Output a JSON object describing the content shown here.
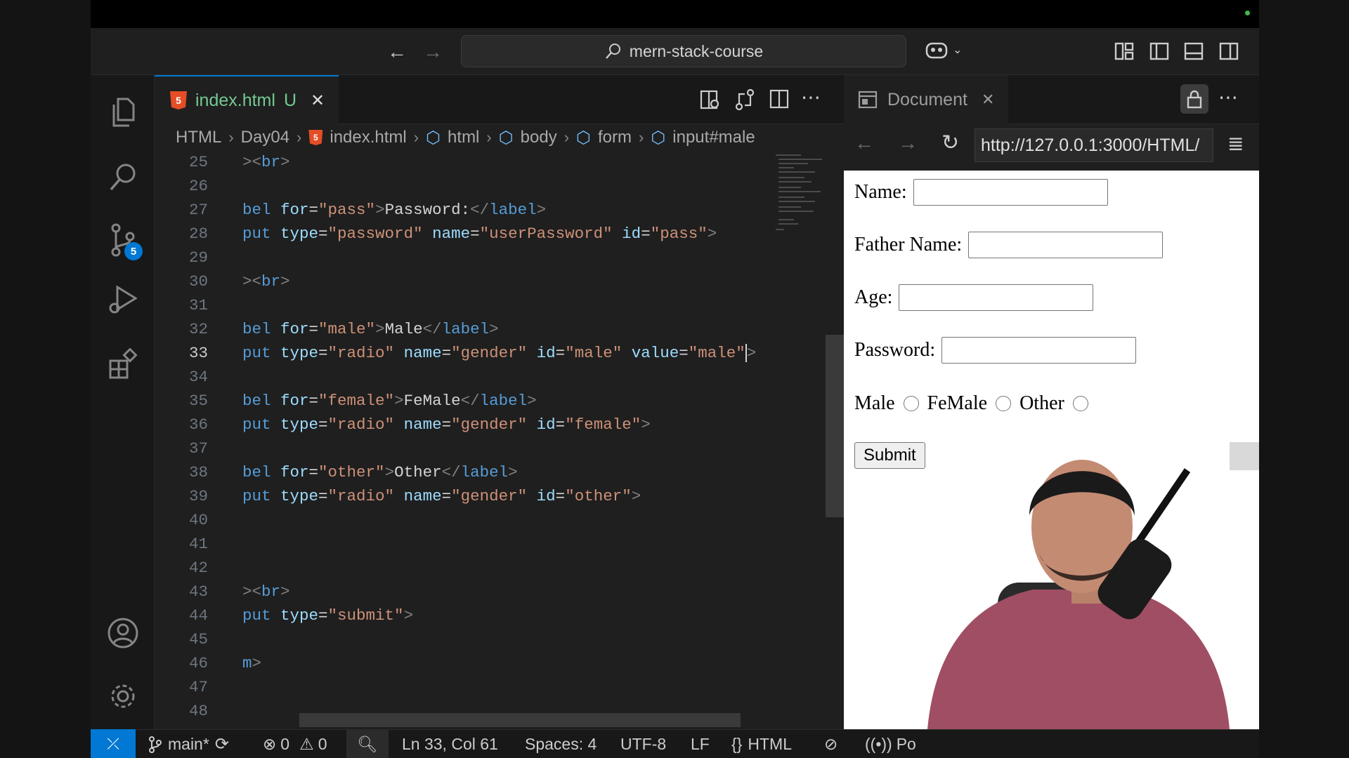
{
  "window": {
    "search_text": "mern-stack-course"
  },
  "activity_bar": {
    "scm_badge": "5"
  },
  "editor": {
    "tab": {
      "filename": "index.html",
      "status": "U"
    },
    "breadcrumb": [
      "HTML",
      "Day04",
      "index.html",
      "html",
      "body",
      "form",
      "input#male"
    ],
    "lines": [
      {
        "n": "25",
        "tokens": [
          {
            "c": "p",
            "v": ">"
          },
          {
            "c": "p",
            "v": "<"
          },
          {
            "c": "t",
            "v": "br"
          },
          {
            "c": "p",
            "v": ">"
          }
        ]
      },
      {
        "n": "26",
        "tokens": []
      },
      {
        "n": "27",
        "tokens": [
          {
            "c": "t",
            "v": "bel "
          },
          {
            "c": "a",
            "v": "for"
          },
          {
            "c": "x",
            "v": "="
          },
          {
            "c": "s",
            "v": "\"pass\""
          },
          {
            "c": "p",
            "v": ">"
          },
          {
            "c": "x",
            "v": "Password:"
          },
          {
            "c": "p",
            "v": "</"
          },
          {
            "c": "t",
            "v": "label"
          },
          {
            "c": "p",
            "v": ">"
          }
        ]
      },
      {
        "n": "28",
        "tokens": [
          {
            "c": "t",
            "v": "put "
          },
          {
            "c": "a",
            "v": "type"
          },
          {
            "c": "x",
            "v": "="
          },
          {
            "c": "s",
            "v": "\"password\""
          },
          {
            "c": "x",
            "v": " "
          },
          {
            "c": "a",
            "v": "name"
          },
          {
            "c": "x",
            "v": "="
          },
          {
            "c": "s",
            "v": "\"userPassword\""
          },
          {
            "c": "x",
            "v": " "
          },
          {
            "c": "a",
            "v": "id"
          },
          {
            "c": "x",
            "v": "="
          },
          {
            "c": "s",
            "v": "\"pass\""
          },
          {
            "c": "p",
            "v": ">"
          }
        ]
      },
      {
        "n": "29",
        "tokens": []
      },
      {
        "n": "30",
        "tokens": [
          {
            "c": "p",
            "v": ">"
          },
          {
            "c": "p",
            "v": "<"
          },
          {
            "c": "t",
            "v": "br"
          },
          {
            "c": "p",
            "v": ">"
          }
        ]
      },
      {
        "n": "31",
        "tokens": []
      },
      {
        "n": "32",
        "tokens": [
          {
            "c": "t",
            "v": "bel "
          },
          {
            "c": "a",
            "v": "for"
          },
          {
            "c": "x",
            "v": "="
          },
          {
            "c": "s",
            "v": "\"male\""
          },
          {
            "c": "p",
            "v": ">"
          },
          {
            "c": "x",
            "v": "Male"
          },
          {
            "c": "p",
            "v": "</"
          },
          {
            "c": "t",
            "v": "label"
          },
          {
            "c": "p",
            "v": ">"
          }
        ]
      },
      {
        "n": "33",
        "current": true,
        "tokens": [
          {
            "c": "t",
            "v": "put "
          },
          {
            "c": "a",
            "v": "type"
          },
          {
            "c": "x",
            "v": "="
          },
          {
            "c": "s",
            "v": "\"radio\""
          },
          {
            "c": "x",
            "v": " "
          },
          {
            "c": "a",
            "v": "name"
          },
          {
            "c": "x",
            "v": "="
          },
          {
            "c": "s",
            "v": "\"gender\""
          },
          {
            "c": "x",
            "v": " "
          },
          {
            "c": "a",
            "v": "id"
          },
          {
            "c": "x",
            "v": "="
          },
          {
            "c": "s",
            "v": "\"male\""
          },
          {
            "c": "x",
            "v": " "
          },
          {
            "c": "a",
            "v": "value"
          },
          {
            "c": "x",
            "v": "="
          },
          {
            "c": "s",
            "v": "\"male\""
          },
          {
            "c": "cursor",
            "v": ""
          },
          {
            "c": "p",
            "v": ">"
          }
        ]
      },
      {
        "n": "34",
        "tokens": []
      },
      {
        "n": "35",
        "tokens": [
          {
            "c": "t",
            "v": "bel "
          },
          {
            "c": "a",
            "v": "for"
          },
          {
            "c": "x",
            "v": "="
          },
          {
            "c": "s",
            "v": "\"female\""
          },
          {
            "c": "p",
            "v": ">"
          },
          {
            "c": "x",
            "v": "FeMale"
          },
          {
            "c": "p",
            "v": "</"
          },
          {
            "c": "t",
            "v": "label"
          },
          {
            "c": "p",
            "v": ">"
          }
        ]
      },
      {
        "n": "36",
        "tokens": [
          {
            "c": "t",
            "v": "put "
          },
          {
            "c": "a",
            "v": "type"
          },
          {
            "c": "x",
            "v": "="
          },
          {
            "c": "s",
            "v": "\"radio\""
          },
          {
            "c": "x",
            "v": " "
          },
          {
            "c": "a",
            "v": "name"
          },
          {
            "c": "x",
            "v": "="
          },
          {
            "c": "s",
            "v": "\"gender\""
          },
          {
            "c": "x",
            "v": " "
          },
          {
            "c": "a",
            "v": "id"
          },
          {
            "c": "x",
            "v": "="
          },
          {
            "c": "s",
            "v": "\"female\""
          },
          {
            "c": "p",
            "v": ">"
          }
        ]
      },
      {
        "n": "37",
        "tokens": []
      },
      {
        "n": "38",
        "tokens": [
          {
            "c": "t",
            "v": "bel "
          },
          {
            "c": "a",
            "v": "for"
          },
          {
            "c": "x",
            "v": "="
          },
          {
            "c": "s",
            "v": "\"other\""
          },
          {
            "c": "p",
            "v": ">"
          },
          {
            "c": "x",
            "v": "Other"
          },
          {
            "c": "p",
            "v": "</"
          },
          {
            "c": "t",
            "v": "label"
          },
          {
            "c": "p",
            "v": ">"
          }
        ]
      },
      {
        "n": "39",
        "tokens": [
          {
            "c": "t",
            "v": "put "
          },
          {
            "c": "a",
            "v": "type"
          },
          {
            "c": "x",
            "v": "="
          },
          {
            "c": "s",
            "v": "\"radio\""
          },
          {
            "c": "x",
            "v": " "
          },
          {
            "c": "a",
            "v": "name"
          },
          {
            "c": "x",
            "v": "="
          },
          {
            "c": "s",
            "v": "\"gender\""
          },
          {
            "c": "x",
            "v": " "
          },
          {
            "c": "a",
            "v": "id"
          },
          {
            "c": "x",
            "v": "="
          },
          {
            "c": "s",
            "v": "\"other\""
          },
          {
            "c": "p",
            "v": ">"
          }
        ]
      },
      {
        "n": "40",
        "tokens": []
      },
      {
        "n": "41",
        "tokens": []
      },
      {
        "n": "42",
        "tokens": []
      },
      {
        "n": "43",
        "tokens": [
          {
            "c": "p",
            "v": ">"
          },
          {
            "c": "p",
            "v": "<"
          },
          {
            "c": "t",
            "v": "br"
          },
          {
            "c": "p",
            "v": ">"
          }
        ]
      },
      {
        "n": "44",
        "tokens": [
          {
            "c": "t",
            "v": "put "
          },
          {
            "c": "a",
            "v": "type"
          },
          {
            "c": "x",
            "v": "="
          },
          {
            "c": "s",
            "v": "\"submit\""
          },
          {
            "c": "p",
            "v": ">"
          }
        ]
      },
      {
        "n": "45",
        "tokens": []
      },
      {
        "n": "46",
        "tokens": [
          {
            "c": "t",
            "v": "m"
          },
          {
            "c": "p",
            "v": ">"
          }
        ]
      },
      {
        "n": "47",
        "tokens": []
      },
      {
        "n": "48",
        "tokens": []
      }
    ]
  },
  "preview": {
    "tab_title": "Document",
    "url": "http://127.0.0.1:3000/HTML/",
    "form": {
      "name_label": "Name:",
      "father_label": "Father Name:",
      "age_label": "Age:",
      "password_label": "Password:",
      "radio_male": "Male",
      "radio_female": "FeMale",
      "radio_other": "Other",
      "submit_label": "Submit"
    }
  },
  "statusbar": {
    "branch": "main*",
    "errors": "0",
    "warnings": "0",
    "cursor": "Ln 33, Col 61",
    "spaces": "Spaces: 4",
    "encoding": "UTF-8",
    "eol": "LF",
    "language": "HTML",
    "port": "Po"
  },
  "colors": {
    "accent": "#0078d4",
    "html_icon": "#e44d26",
    "tab_filename": "#73c991",
    "tag": "#569cd6",
    "attr": "#9cdcfe",
    "string": "#ce9178"
  }
}
